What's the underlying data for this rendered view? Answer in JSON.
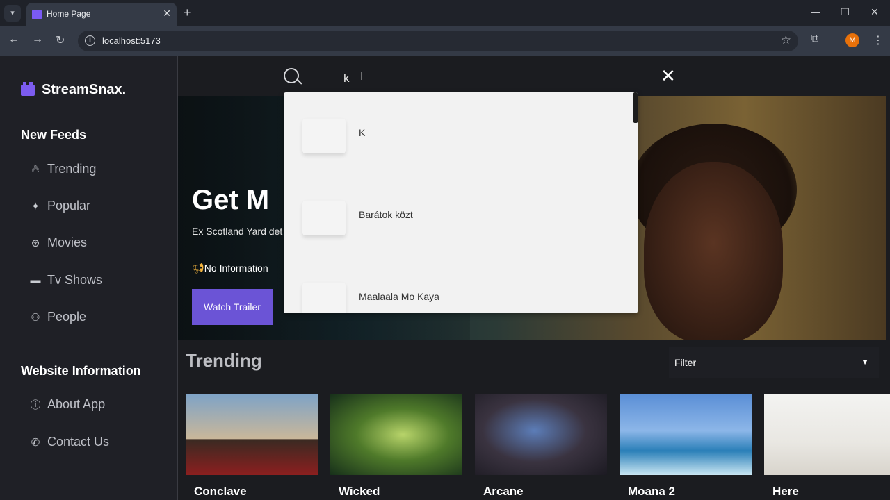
{
  "browser": {
    "tab_title": "Home Page",
    "url": "localhost:5173",
    "avatar_letter": "M"
  },
  "sidebar": {
    "logo": "StreamSnax.",
    "sections": [
      {
        "title": "New Feeds",
        "items": [
          {
            "label": "Trending",
            "icon": "flame-icon"
          },
          {
            "label": "Popular",
            "icon": "sparkle-icon"
          },
          {
            "label": "Movies",
            "icon": "film-reel-icon"
          },
          {
            "label": "Tv Shows",
            "icon": "tv-icon"
          },
          {
            "label": "People",
            "icon": "people-icon"
          }
        ]
      },
      {
        "title": "Website Information",
        "items": [
          {
            "label": "About App",
            "icon": "info-icon"
          },
          {
            "label": "Contact Us",
            "icon": "phone-icon"
          }
        ]
      }
    ]
  },
  "search": {
    "value": "k",
    "results": [
      {
        "label": "K"
      },
      {
        "label": "Barátok közt"
      },
      {
        "label": "Maalaala Mo Kaya"
      }
    ]
  },
  "hero": {
    "title": "Get M",
    "description": "Ex Scotland Yard det work missing person",
    "info": "No Information",
    "button": "Watch Trailer"
  },
  "trending": {
    "title": "Trending",
    "filter_label": "Filter",
    "cards": [
      {
        "title": "Conclave"
      },
      {
        "title": "Wicked"
      },
      {
        "title": "Arcane"
      },
      {
        "title": "Moana 2"
      },
      {
        "title": "Here"
      }
    ]
  },
  "colors": {
    "accent": "#6b54d6",
    "logo": "#7c5cf0"
  }
}
